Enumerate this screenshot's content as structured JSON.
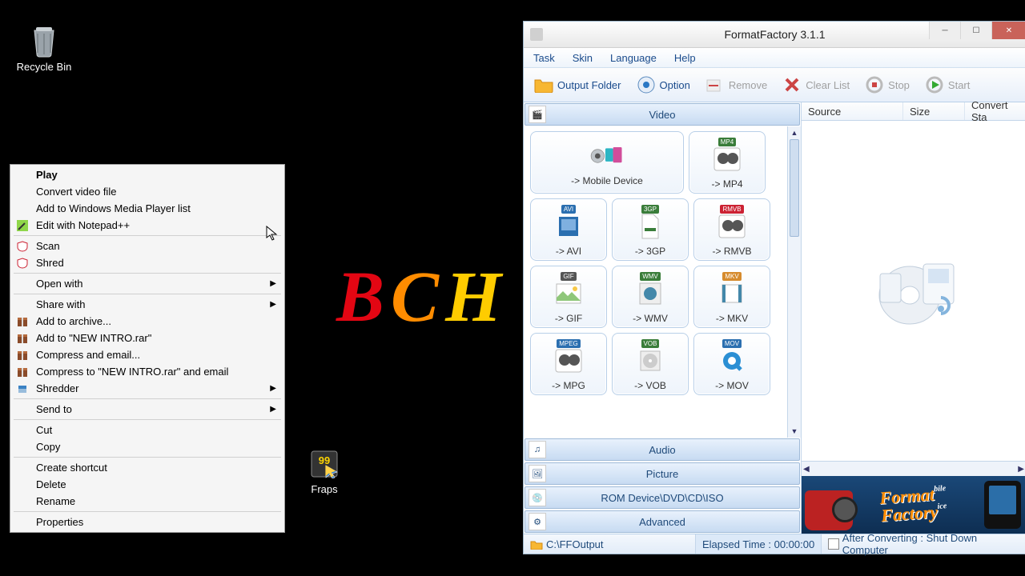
{
  "desktop": {
    "recycle_bin": "Recycle Bin",
    "fraps": "Fraps"
  },
  "bg_logo": {
    "b": "B",
    "c": "C",
    "h": "H"
  },
  "context_menu": {
    "play": "Play",
    "convert": "Convert video file",
    "add_wmp": "Add to Windows Media Player list",
    "edit_npp": "Edit with Notepad++",
    "scan": "Scan",
    "shred": "Shred",
    "open_with": "Open with",
    "share_with": "Share with",
    "add_archive": "Add to archive...",
    "add_to_rar": "Add to \"NEW INTRO.rar\"",
    "compress_email": "Compress and email...",
    "compress_to_rar_email": "Compress to \"NEW INTRO.rar\" and email",
    "shredder": "Shredder",
    "send_to": "Send to",
    "cut": "Cut",
    "copy": "Copy",
    "create_shortcut": "Create shortcut",
    "delete": "Delete",
    "rename": "Rename",
    "properties": "Properties"
  },
  "ff": {
    "title": "FormatFactory 3.1.1",
    "menu": {
      "task": "Task",
      "skin": "Skin",
      "language": "Language",
      "help": "Help"
    },
    "toolbar": {
      "output_folder": "Output Folder",
      "option": "Option",
      "remove": "Remove",
      "clear_list": "Clear List",
      "stop": "Stop",
      "start": "Start"
    },
    "categories": {
      "video": "Video",
      "audio": "Audio",
      "picture": "Picture",
      "rom": "ROM Device\\DVD\\CD\\ISO",
      "advanced": "Advanced"
    },
    "formats": {
      "mobile": "-> Mobile Device",
      "mp4": "-> MP4",
      "avi": "-> AVI",
      "3gp": "-> 3GP",
      "rmvb": "-> RMVB",
      "gif": "-> GIF",
      "wmv": "-> WMV",
      "mkv": "-> MKV",
      "mpg": "-> MPG",
      "vob": "-> VOB",
      "mov": "-> MOV"
    },
    "columns": {
      "source": "Source",
      "size": "Size",
      "status": "Convert Sta"
    },
    "banner": {
      "line1": "Format",
      "line2": "Factory",
      "small1": "bile",
      "small2": "ice"
    },
    "status": {
      "output_path": "C:\\FFOutput",
      "elapsed": "Elapsed Time : 00:00:00",
      "after": "After Converting : Shut Down Computer"
    }
  }
}
